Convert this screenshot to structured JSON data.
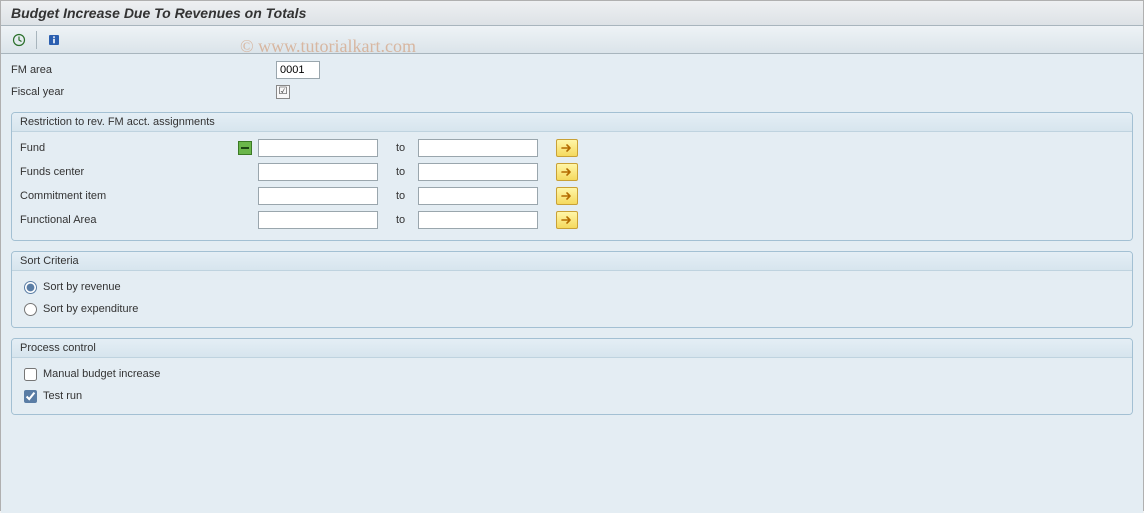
{
  "header": {
    "title": "Budget Increase Due To Revenues on Totals"
  },
  "watermark": "© www.tutorialkart.com",
  "topFields": {
    "fmArea": {
      "label": "FM area",
      "value": "0001"
    },
    "fiscalYear": {
      "label": "Fiscal year",
      "checked_glyph": "☑"
    }
  },
  "restriction": {
    "title": "Restriction to rev. FM acct. assignments",
    "to_label": "to",
    "rows": [
      {
        "label": "Fund",
        "from": "",
        "to": "",
        "hasSelIndicator": true
      },
      {
        "label": "Funds center",
        "from": "",
        "to": "",
        "hasSelIndicator": false
      },
      {
        "label": "Commitment item",
        "from": "",
        "to": "",
        "hasSelIndicator": false
      },
      {
        "label": "Functional Area",
        "from": "",
        "to": "",
        "hasSelIndicator": false
      }
    ]
  },
  "sort": {
    "title": "Sort Criteria",
    "opt1": "Sort by revenue",
    "opt2": "Sort by expenditure",
    "selected": "revenue"
  },
  "process": {
    "title": "Process control",
    "manual": {
      "label": "Manual budget increase",
      "checked": false
    },
    "test": {
      "label": "Test run",
      "checked": true
    }
  }
}
